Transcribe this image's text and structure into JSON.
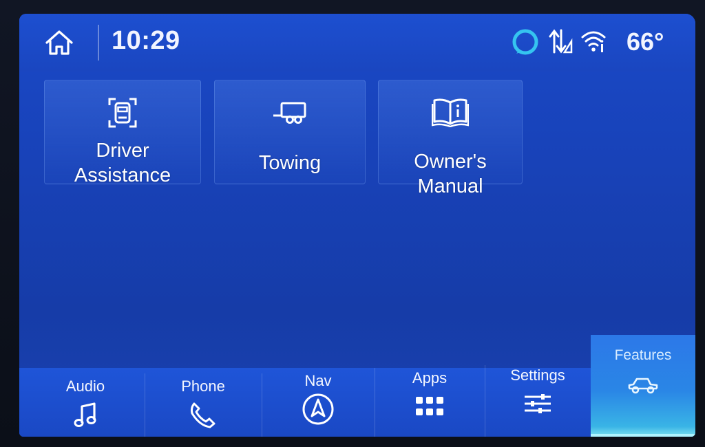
{
  "statusbar": {
    "time": "10:29",
    "temperature": "66°",
    "icons": [
      "home-icon",
      "alexa-icon",
      "signal-arrows-icon",
      "wifi-icon"
    ]
  },
  "tiles": [
    {
      "label_line1": "Driver",
      "label_line2": "Assistance",
      "icon": "driver-assistance-icon"
    },
    {
      "label": "Towing",
      "icon": "trailer-icon"
    },
    {
      "label": "Owner's Manual",
      "icon": "book-info-icon"
    }
  ],
  "nav": {
    "audio": "Audio",
    "phone": "Phone",
    "nav": "Nav",
    "apps": "Apps",
    "settings": "Settings",
    "features": "Features",
    "active": "features"
  },
  "colors": {
    "background": "#1842b8",
    "active_tab": "#2a86e6",
    "text": "#ffffff",
    "alexa_ring": "#35c4f0"
  }
}
